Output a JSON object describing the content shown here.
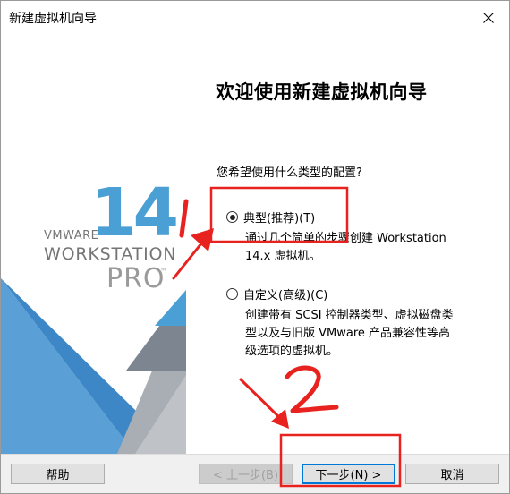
{
  "window": {
    "title": "新建虚拟机向导"
  },
  "branding": {
    "version": "14",
    "vmware": "VMWARE",
    "product": "WORKSTATION",
    "edition": "PRO",
    "trademark": "™"
  },
  "content": {
    "heading": "欢迎使用新建虚拟机向导",
    "question": "您希望使用什么类型的配置?",
    "options": [
      {
        "label": "典型(推荐)(T)",
        "checked": true,
        "description_lines": [
          "通过几个简单的步骤创建 Workstation",
          "14.x 虚拟机。"
        ]
      },
      {
        "label": "自定义(高级)(C)",
        "checked": false,
        "description_lines": [
          "创建带有 SCSI 控制器类型、虚拟磁盘类",
          "型以及与旧版 VMware 产品兼容性等高",
          "级选项的虚拟机。"
        ]
      }
    ]
  },
  "buttons": {
    "help": "帮助",
    "back": "< 上一步(B)",
    "next": "下一步(N) >",
    "cancel": "取消"
  },
  "annotations": {
    "number_1": "1",
    "number_2": "2",
    "color": "#e8231f"
  },
  "colors": {
    "brand_blue": "#4a9fd4",
    "accent": "#0078d7"
  }
}
